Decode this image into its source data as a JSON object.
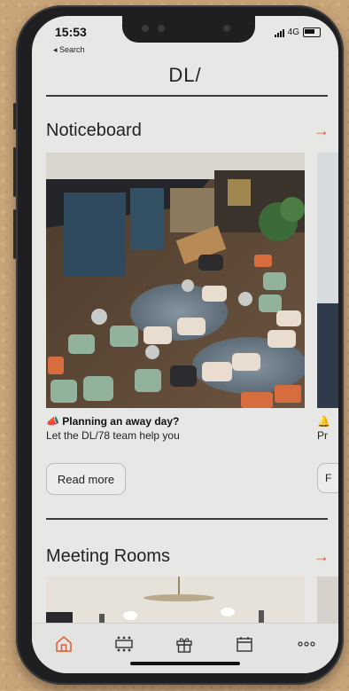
{
  "status": {
    "time": "15:53",
    "back": "◂ Search",
    "network": "4G"
  },
  "app": {
    "title": "DL/"
  },
  "noticeboard": {
    "heading": "Noticeboard",
    "arrow": "→",
    "card": {
      "emoji": "📣",
      "title": "Planning an away day?",
      "subtitle": "Let the DL/78 team help you",
      "button": "Read more"
    },
    "peek": {
      "emoji": "🔔",
      "subtitle": "Pr",
      "button": "F"
    }
  },
  "meeting_rooms": {
    "heading": "Meeting Rooms",
    "arrow": "→"
  },
  "tabs": [
    {
      "icon": "home-icon",
      "active": true,
      "color": "#e0613a"
    },
    {
      "icon": "meeting-room-icon"
    },
    {
      "icon": "gift-icon"
    },
    {
      "icon": "calendar-icon"
    },
    {
      "icon": "more-icon"
    }
  ],
  "colors": {
    "accent": "#e0613a",
    "screen": "#e7e7e6"
  }
}
